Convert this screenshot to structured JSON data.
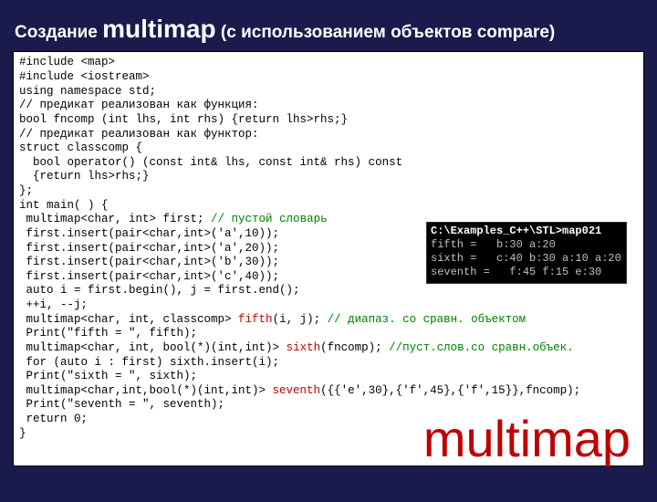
{
  "title": {
    "prefix": "Создание ",
    "big": "multimap",
    "suffix": " (с использованием объектов compare)"
  },
  "code": {
    "l1": "#include <map>",
    "l2": "#include <iostream>",
    "l3": "using namespace std;",
    "l4": "// предикат реализован как функция:",
    "l5": "bool fncomp (int lhs, int rhs) {return lhs>rhs;}",
    "l6": "// предикат реализован как функтор:",
    "l7": "struct classcomp {",
    "l8": "  bool operator() (const int& lhs, const int& rhs) const",
    "l9": "  {return lhs>rhs;}",
    "l10": "};",
    "l11": "int main( ) {",
    "l12a": " multimap<char, int> first; ",
    "l12c": "// пустой словарь",
    "l13": " first.insert(pair<char,int>('a',10));",
    "l14": " first.insert(pair<char,int>('a',20));",
    "l15": " first.insert(pair<char,int>('b',30));",
    "l16": " first.insert(pair<char,int>('c',40));",
    "l17": " auto i = first.begin(), j = first.end();",
    "l18": " ++i, --j;",
    "l19a": " multimap<char, int, classcomp> ",
    "l19r": "fifth",
    "l19b": "(i, j); ",
    "l19c": "// диапаз. со сравн. объектом",
    "l20": " Print(\"fifth = \", fifth);",
    "l21a": " multimap<char, int, bool(*)(int,int)> ",
    "l21r": "sixth",
    "l21b": "(fncomp); ",
    "l21c": "//пуст.слов.со сравн.объек.",
    "l22": " for (auto i : first) sixth.insert(i);",
    "l23": " Print(\"sixth = \", sixth);",
    "l24a": " multimap<char,int,bool(*)(int,int)> ",
    "l24r": "seventh",
    "l24b": "({{'e',30},{'f',45},{'f',15}},fncomp);",
    "l25": " Print(\"seventh = \", seventh);",
    "l26": " return 0;",
    "l27": "}"
  },
  "console": {
    "header": "C:\\Examples_C++\\STL>map021",
    "l1": "fifth =   b:30 a:20",
    "l2": "sixth =   c:40 b:30 a:10 a:20",
    "l3": "seventh =   f:45 f:15 e:30"
  },
  "watermark": "multimap"
}
